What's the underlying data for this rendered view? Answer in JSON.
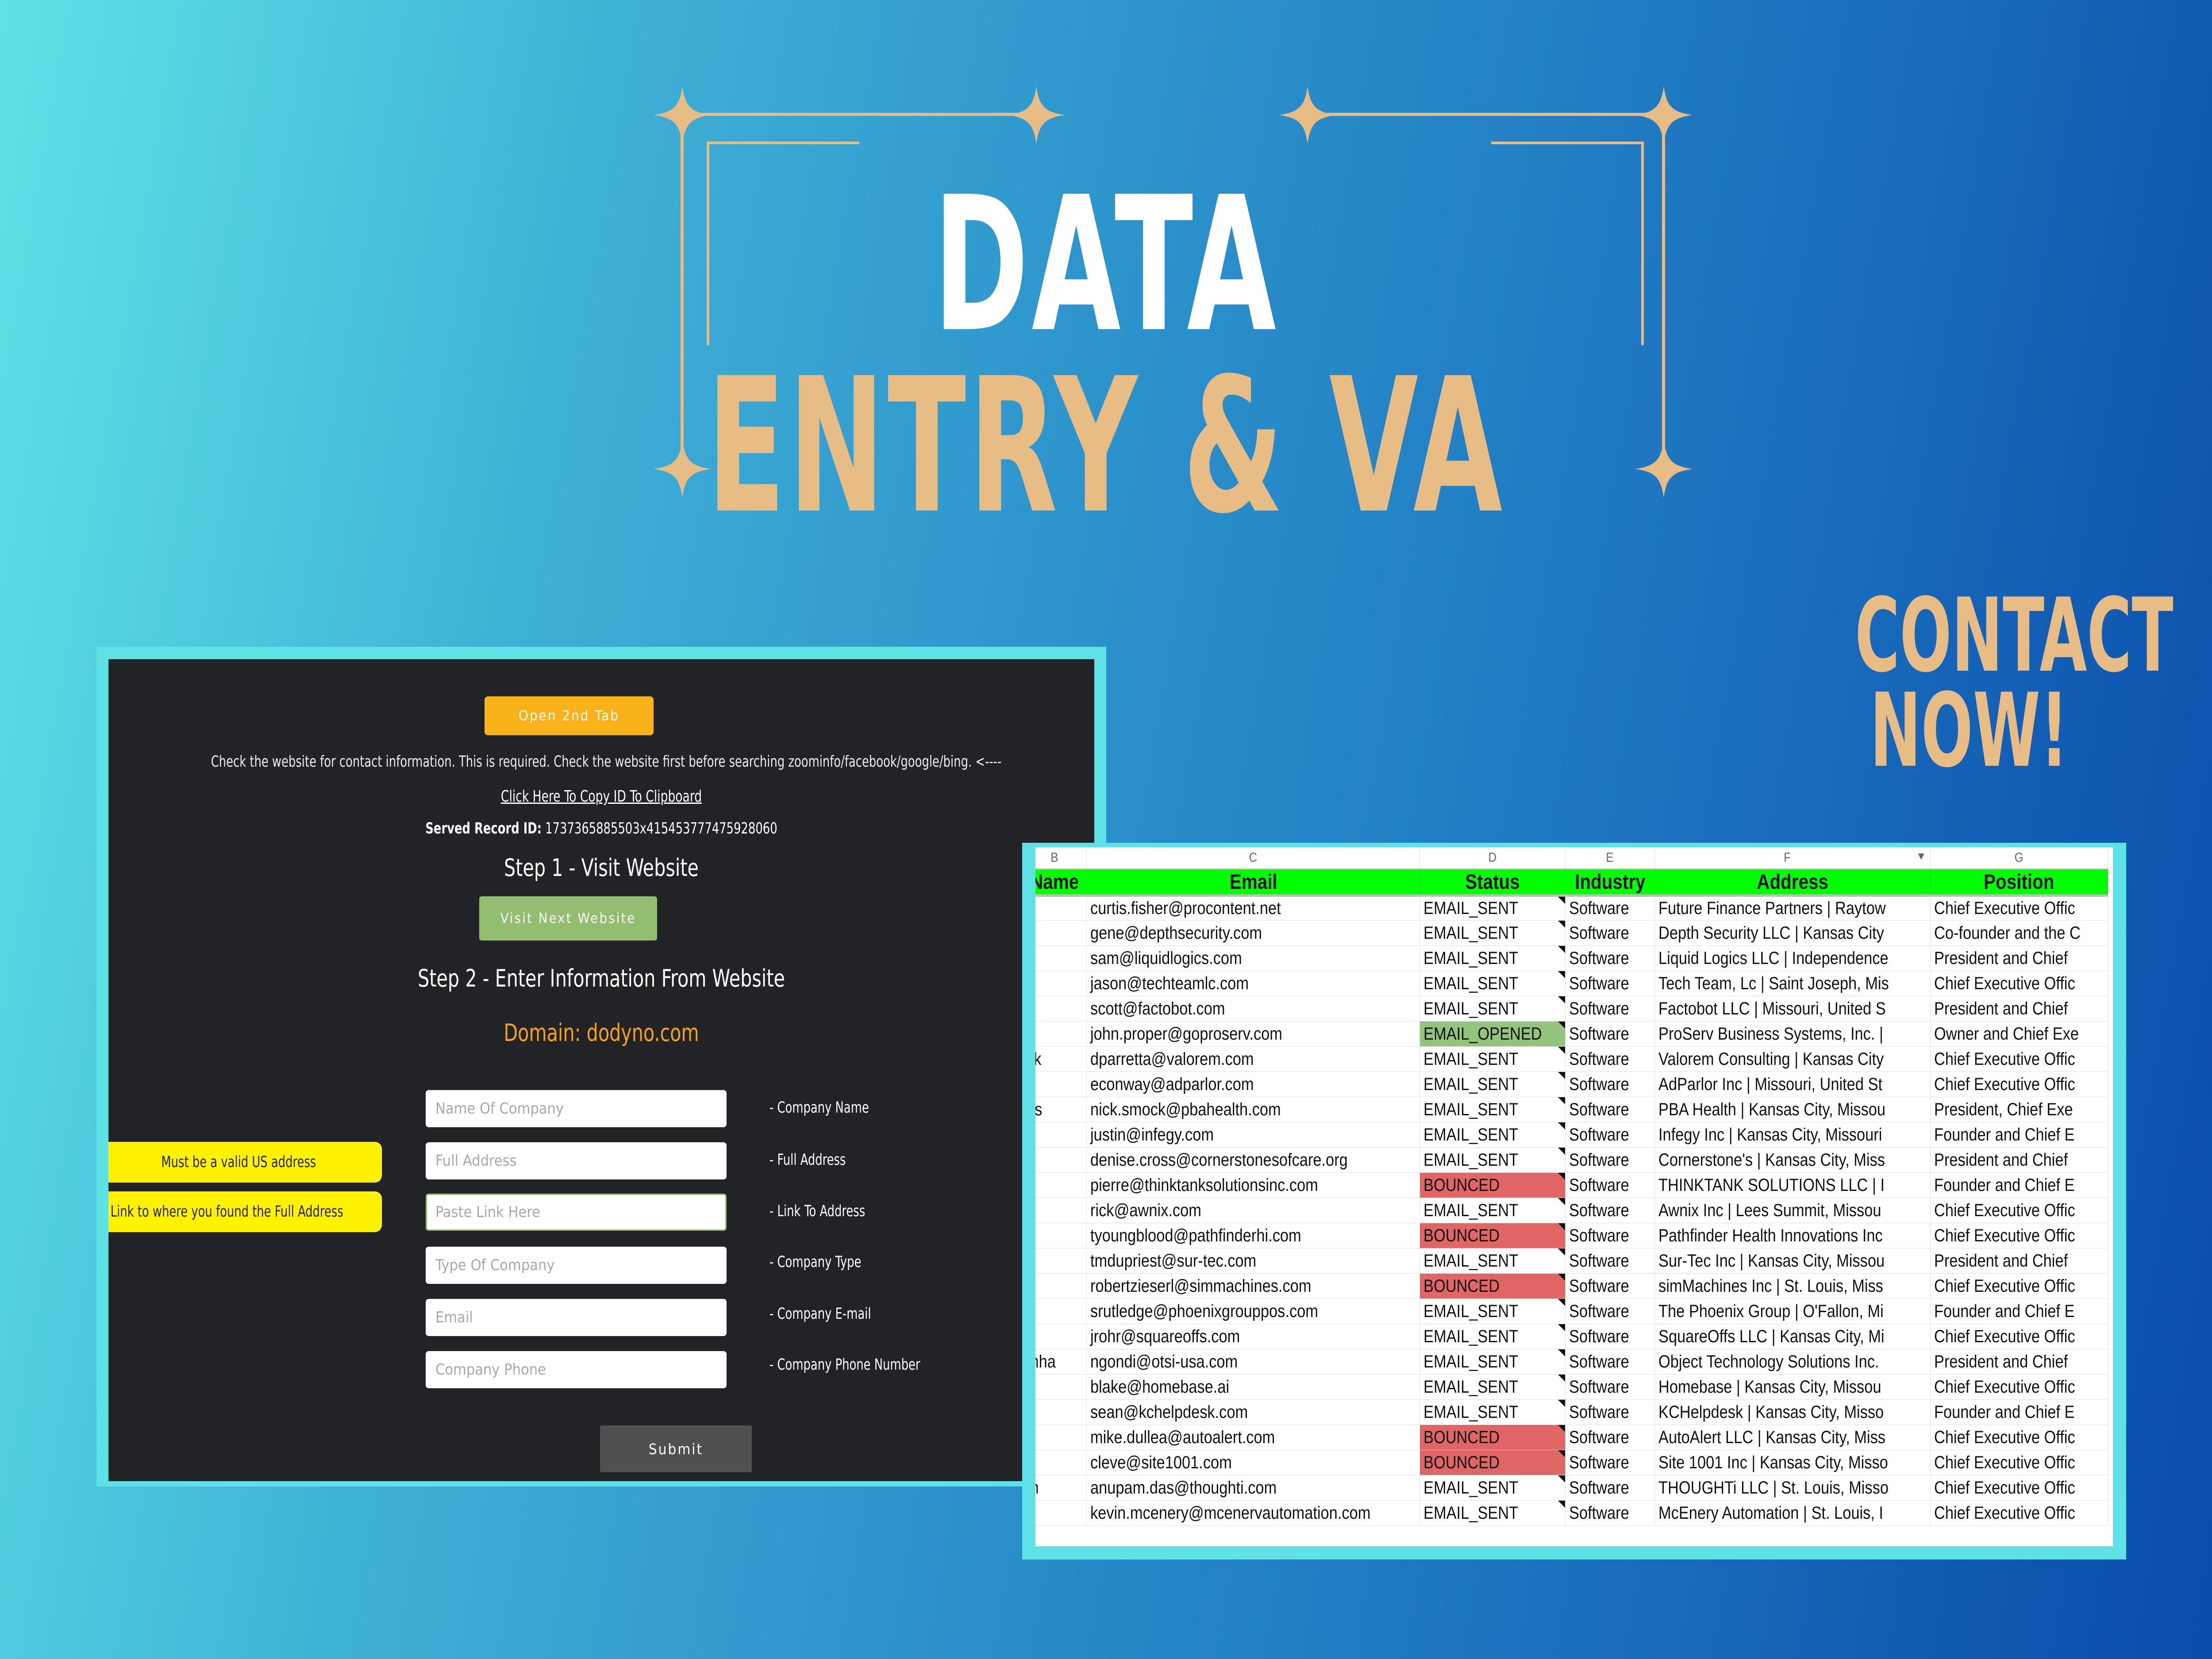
{
  "banner": {
    "title_line1": "DATA",
    "title_line2": "ENTRY & VA",
    "cta": "CONTACT NOW!",
    "accent_color": "#e8bd85"
  },
  "form_panel": {
    "open_tab_button": "Open 2nd Tab",
    "instruction": "Check the website for contact information. This is required. Check the website first before searching zoominfo/facebook/google/bing. <----",
    "copy_link": "Click Here To Copy ID To Clipboard",
    "record_id_label": "Served Record ID:",
    "record_id_value": "1737365885503x415453777475928060",
    "step1_heading": "Step 1 - Visit Website",
    "visit_button": "Visit Next Website",
    "step2_heading": "Step 2 - Enter Information From Website",
    "domain_text": "Domain: dodyno.com",
    "fields": [
      {
        "placeholder": "Name Of Company",
        "value": "",
        "label": "- Company Name"
      },
      {
        "placeholder": "Full Address",
        "value": "",
        "label": "- Full Address"
      },
      {
        "placeholder": "Paste Link Here",
        "value": "",
        "label": "- Link To Address"
      },
      {
        "placeholder": "Type Of Company",
        "value": "",
        "label": "- Company Type"
      },
      {
        "placeholder": "Email",
        "value": "",
        "label": "- Company E-mail"
      },
      {
        "placeholder": "Company Phone",
        "value": "",
        "label": "- Company Phone Number"
      }
    ],
    "hints": [
      "Must be a valid US address",
      "Link to where you found the Full Address"
    ],
    "submit_button": "Submit",
    "colors": {
      "open_tab": "#f9b21a",
      "visit": "#93bd6f",
      "domain": "#f5a30f",
      "hint": "#fff200"
    }
  },
  "spreadsheet": {
    "column_letters": [
      "B",
      "C",
      "D",
      "E",
      "F",
      "G"
    ],
    "headers": [
      "Name",
      "Email",
      "Status",
      "Industry",
      "Address",
      "Position"
    ],
    "header_color": "#00ff00",
    "status_colors": {
      "BOUNCED": "#e06666",
      "EMAIL_OPENED": "#93c47d"
    },
    "rows": [
      {
        "name": "",
        "email": "curtis.fisher@procontent.net",
        "status": "EMAIL_SENT",
        "industry": "Software",
        "address": "Future Finance Partners | Raytow",
        "position": "Chief Executive Offic"
      },
      {
        "name": "",
        "email": "gene@depthsecurity.com",
        "status": "EMAIL_SENT",
        "industry": "Software",
        "address": "Depth Security LLC | Kansas City",
        "position": "Co-founder and the C"
      },
      {
        "name": "",
        "email": "sam@liquidlogics.com",
        "status": "EMAIL_SENT",
        "industry": "Software",
        "address": "Liquid Logics LLC | Independence",
        "position": "President and Chief"
      },
      {
        "name": "",
        "email": "jason@techteamlc.com",
        "status": "EMAIL_SENT",
        "industry": "Software",
        "address": "Tech Team, Lc | Saint Joseph, Mis",
        "position": "Chief Executive Offic"
      },
      {
        "name": "",
        "email": "scott@factobot.com",
        "status": "EMAIL_SENT",
        "industry": "Software",
        "address": "Factobot LLC | Missouri, United S",
        "position": "President and Chief"
      },
      {
        "name": "",
        "email": "john.proper@goproserv.com",
        "status": "EMAIL_OPENED",
        "industry": "Software",
        "address": "ProServ Business Systems, Inc. |",
        "position": "Owner and Chief Exe"
      },
      {
        "name": "ck",
        "email": "dparretta@valorem.com",
        "status": "EMAIL_SENT",
        "industry": "Software",
        "address": "Valorem Consulting | Kansas City",
        "position": "Chief Executive Offic"
      },
      {
        "name": "",
        "email": "econway@adparlor.com",
        "status": "EMAIL_SENT",
        "industry": "Software",
        "address": "AdParlor Inc | Missouri, United St",
        "position": "Chief Executive Offic"
      },
      {
        "name": "as",
        "email": "nick.smock@pbahealth.com",
        "status": "EMAIL_SENT",
        "industry": "Software",
        "address": "PBA Health | Kansas City, Missou",
        "position": "President, Chief Exe"
      },
      {
        "name": "",
        "email": "justin@infegy.com",
        "status": "EMAIL_SENT",
        "industry": "Software",
        "address": "Infegy Inc | Kansas City, Missouri",
        "position": "Founder and Chief E"
      },
      {
        "name": "",
        "email": "denise.cross@cornerstonesofcare.org",
        "status": "EMAIL_SENT",
        "industry": "Software",
        "address": "Cornerstone's | Kansas City, Miss",
        "position": "President and Chief"
      },
      {
        "name": "",
        "email": "pierre@thinktanksolutionsinc.com",
        "status": "BOUNCED",
        "industry": "Software",
        "address": "THINKTANK SOLUTIONS LLC | I",
        "position": "Founder and Chief E"
      },
      {
        "name": "",
        "email": "rick@awnix.com",
        "status": "EMAIL_SENT",
        "industry": "Software",
        "address": "Awnix Inc | Lees Summit, Missou",
        "position": "Chief Executive Offic"
      },
      {
        "name": "",
        "email": "tyoungblood@pathfinderhi.com",
        "status": "BOUNCED",
        "industry": "Software",
        "address": "Pathfinder Health Innovations Inc",
        "position": "Chief Executive Offic"
      },
      {
        "name": "",
        "email": "tmdupriest@sur-tec.com",
        "status": "EMAIL_SENT",
        "industry": "Software",
        "address": "Sur-Tec Inc | Kansas City, Missou",
        "position": "President and Chief"
      },
      {
        "name": "",
        "email": "robertzieserl@simmachines.com",
        "status": "BOUNCED",
        "industry": "Software",
        "address": "simMachines Inc | St. Louis, Miss",
        "position": "Chief Executive Offic"
      },
      {
        "name": "",
        "email": "srutledge@phoenixgrouppos.com",
        "status": "EMAIL_SENT",
        "industry": "Software",
        "address": "The Phoenix Group | O'Fallon, Mi",
        "position": "Founder and Chief E"
      },
      {
        "name": "",
        "email": "jrohr@squareoffs.com",
        "status": "EMAIL_SENT",
        "industry": "Software",
        "address": "SquareOffs LLC | Kansas City, Mi",
        "position": "Chief Executive Offic"
      },
      {
        "name": "mha",
        "email": "ngondi@otsi-usa.com",
        "status": "EMAIL_SENT",
        "industry": "Software",
        "address": "Object Technology Solutions Inc.",
        "position": "President and Chief"
      },
      {
        "name": "",
        "email": "blake@homebase.ai",
        "status": "EMAIL_SENT",
        "industry": "Software",
        "address": "Homebase | Kansas City, Missou",
        "position": "Chief Executive Offic"
      },
      {
        "name": "",
        "email": "sean@kchelpdesk.com",
        "status": "EMAIL_SENT",
        "industry": "Software",
        "address": "KCHelpdesk | Kansas City, Misso",
        "position": "Founder and Chief E"
      },
      {
        "name": "",
        "email": "mike.dullea@autoalert.com",
        "status": "BOUNCED",
        "industry": "Software",
        "address": "AutoAlert LLC | Kansas City, Miss",
        "position": "Chief Executive Offic"
      },
      {
        "name": "",
        "email": "cleve@site1001.com",
        "status": "BOUNCED",
        "industry": "Software",
        "address": "Site 1001 Inc | Kansas City, Misso",
        "position": "Chief Executive Offic"
      },
      {
        "name": "m",
        "email": "anupam.das@thoughti.com",
        "status": "EMAIL_SENT",
        "industry": "Software",
        "address": "THOUGHTi LLC | St. Louis, Misso",
        "position": "Chief Executive Offic"
      },
      {
        "name": "",
        "email": "kevin.mcenery@mcenervautomation.com",
        "status": "EMAIL_SENT",
        "industry": "Software",
        "address": "McEnery Automation | St. Louis, I",
        "position": "Chief Executive Offic"
      }
    ]
  }
}
